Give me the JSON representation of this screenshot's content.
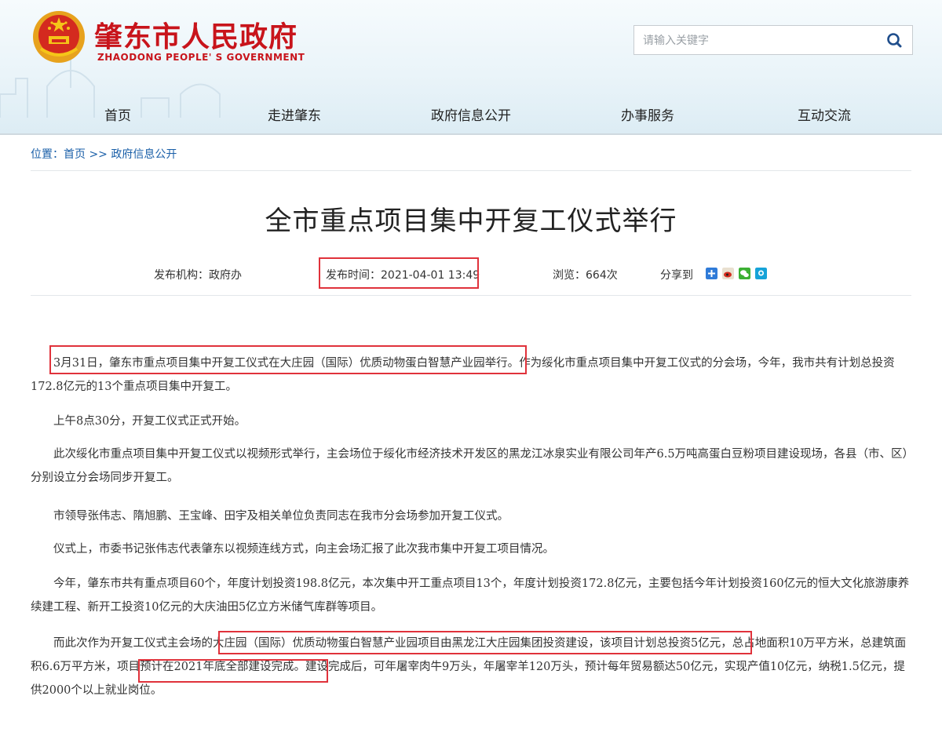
{
  "site": {
    "title": "肇东市人民政府",
    "subtitle": "ZHAODONG PEOPLE' S GOVERNMENT",
    "emblem_icon": "national-emblem-icon",
    "brand_color": "#c8141b"
  },
  "search": {
    "placeholder": "请输入关键字",
    "button_icon": "search-icon"
  },
  "nav": {
    "items": [
      "首页",
      "走进肇东",
      "政府信息公开",
      "办事服务",
      "互动交流"
    ]
  },
  "breadcrumb": {
    "prefix": "位置：",
    "home": "首页",
    "separator": " >> ",
    "current": "政府信息公开"
  },
  "article": {
    "title": "全市重点项目集中开复工仪式举行",
    "meta": {
      "publisher": "发布机构：政府办",
      "time": "发布时间：2021-04-01 13:49",
      "views": "浏览：664次",
      "share_label": "分享到",
      "share_icons": [
        "qzone-share-icon",
        "weibo-share-icon",
        "wechat-share-icon",
        "qq-share-icon"
      ]
    },
    "paragraphs": [
      {
        "hl": "3月31日，肇东市重点项目集中开复工仪式在大庄园（国际）优质动物蛋白智慧产业园举行。",
        "rest": "作为绥化市重点项目集中开复工仪式的分会场，今年，我市共有计划总投资172.8亿元的13个重点项目集中开复工。"
      },
      {
        "text": "上午8点30分，开复工仪式正式开始。"
      },
      {
        "text": "此次绥化市重点项目集中开复工仪式以视频形式举行，主会场位于绥化市经济技术开发区的黑龙江冰泉实业有限公司年产6.5万吨高蛋白豆粉项目建设现场，各县（市、区）分别设立分会场同步开复工。"
      },
      {
        "text": "市领导张伟志、隋旭鹏、王宝峰、田宇及相关单位负责同志在我市分会场参加开复工仪式。"
      },
      {
        "text": "仪式上，市委书记张伟志代表肇东以视频连线方式，向主会场汇报了此次我市集中开复工项目情况。"
      },
      {
        "text": "今年，肇东市共有重点项目60个，年度计划投资198.8亿元，本次集中开工重点项目13个，年度计划投资172.8亿元，主要包括今年计划投资160亿元的恒大文化旅游康养续建工程、新开工投资10亿元的大庆油田5亿立方米储气库群等项目。"
      },
      {
        "a": "而此次作为开复工仪式主会场的",
        "hl1": "大庄园（国际）优质动物蛋白智慧产业园项目由黑龙江大庄园集团投资建设，该项目计划总投资5亿元，",
        "b": "总占地面积10万平方米，总建筑面积6.6万平方米，",
        "hl2": "项目预计在2021年底全部建设完成。",
        "c": "建设完成后，可年屠宰肉牛9万头，年屠宰羊120万头，预计每年贸易额达50亿元，实现产值10亿元，纳税1.5亿元，提供2000个以上就业岗位。"
      }
    ]
  },
  "colors": {
    "link": "#1a5fa8",
    "highlight_box": "#e0323b"
  }
}
